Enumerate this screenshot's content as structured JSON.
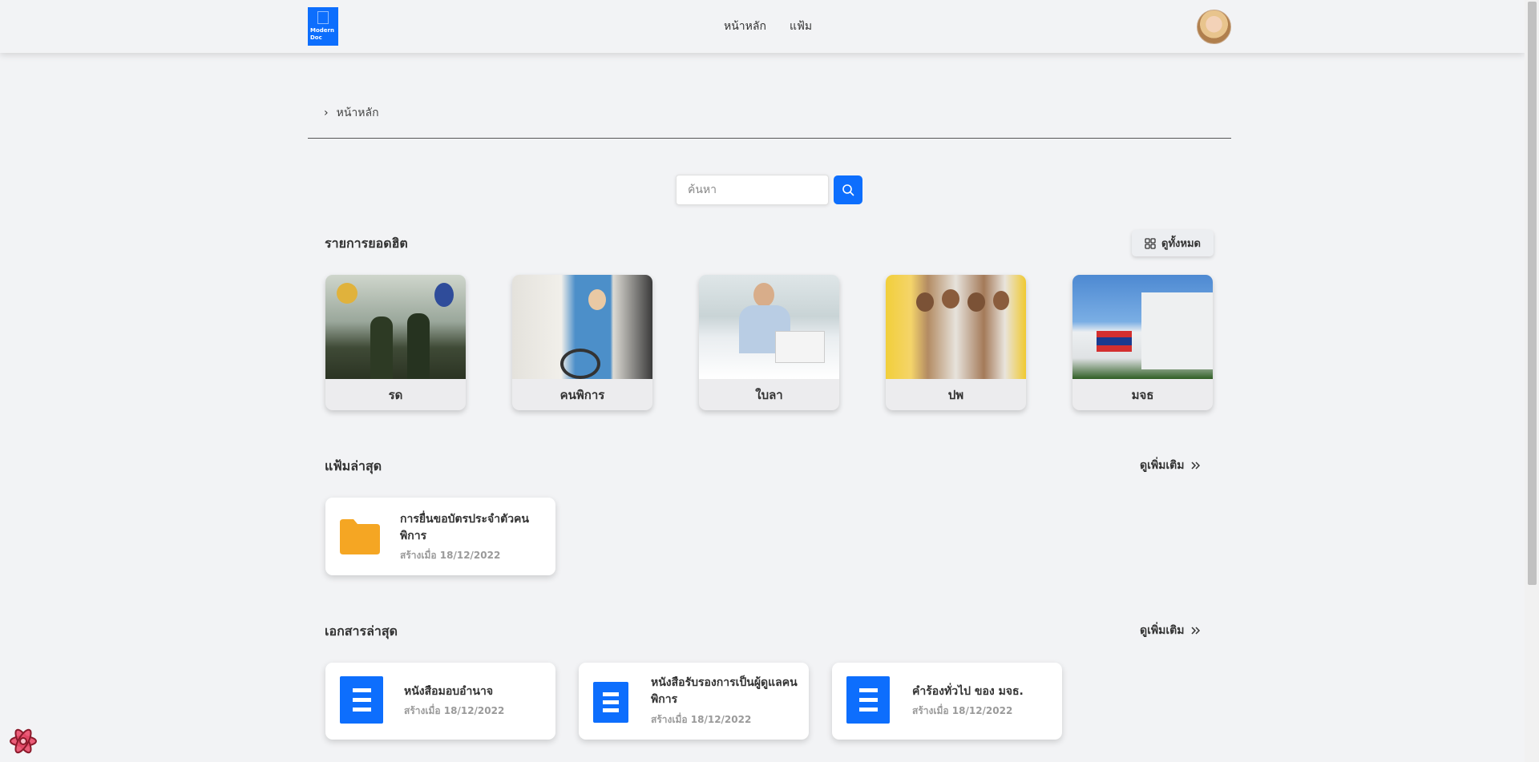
{
  "app": {
    "logo_text_line1": "Modern",
    "logo_text_line2": "Doc"
  },
  "nav": {
    "home": "หน้าหลัก",
    "folders": "แฟ้ม"
  },
  "breadcrumb": {
    "current": "หน้าหลัก"
  },
  "search": {
    "placeholder": "ค้นหา"
  },
  "popular": {
    "title": "รายการยอดฮิต",
    "view_all": "ดูทั้งหมด",
    "items": [
      {
        "label": "รด"
      },
      {
        "label": "คนพิการ"
      },
      {
        "label": "ใบลา"
      },
      {
        "label": "ปพ"
      },
      {
        "label": "มจธ"
      }
    ]
  },
  "recent_folders": {
    "title": "แฟ้มล่าสุด",
    "see_more": "ดูเพิ่มเติม",
    "items": [
      {
        "title": "การยื่นขอบัตรประจำตัวคนพิการ",
        "date": "สร้างเมื่อ 18/12/2022"
      }
    ]
  },
  "recent_documents": {
    "title": "เอกสารล่าสุด",
    "see_more": "ดูเพิ่มเติม",
    "items": [
      {
        "title": "หนังสือมอบอำนาจ",
        "date": "สร้างเมื่อ 18/12/2022"
      },
      {
        "title": "หนังสือรับรองการเป็นผู้ดูแลคนพิการ",
        "date": "สร้างเมื่อ 18/12/2022"
      },
      {
        "title": "คำร้องทั่วไป ของ มจธ.",
        "date": "สร้างเมื่อ 18/12/2022"
      }
    ]
  },
  "colors": {
    "primary": "#0d6efd",
    "folder": "#f5a623",
    "background": "#f2f3f5"
  },
  "icons": {
    "search": "search-icon",
    "grid": "grid-icon",
    "double_chevron": "double-chevron-right-icon",
    "folder": "folder-icon",
    "document": "document-icon",
    "debug": "react-debug-icon"
  }
}
